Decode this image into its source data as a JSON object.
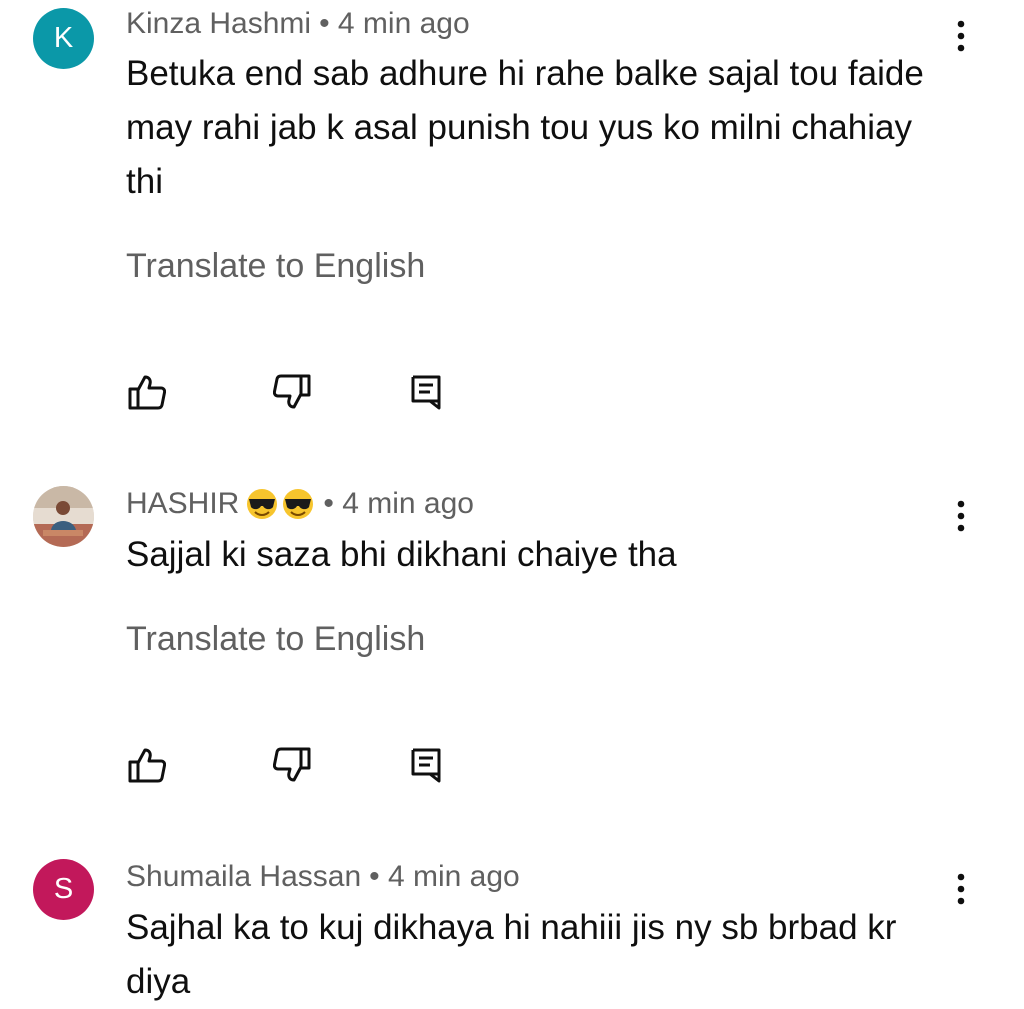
{
  "comments": [
    {
      "author": "Kinza Hashmi",
      "time": "• 4 min ago",
      "avatar_letter": "K",
      "avatar_color": "#0b98a8",
      "text": "Betuka end sab adhure hi rahe balke sajal tou faide may rahi jab k asal punish tou yus ko milni chahiay thi",
      "translate": "Translate to English"
    },
    {
      "author": "HASHIR",
      "time": "• 4 min ago",
      "author_emoji": "smiling-face-with-sunglasses-icon",
      "text": "Sajjal ki saza bhi dikhani chaiye tha",
      "translate": "Translate to English"
    },
    {
      "author": "Shumaila Hassan",
      "time": "• 4 min ago",
      "avatar_letter": "S",
      "avatar_color": "#c2185b",
      "text": "Sajhal ka to kuj dikhaya hi nahiii jis ny sb brbad kr diya"
    }
  ],
  "icons": {
    "like": "thumbs-up-icon",
    "dislike": "thumbs-down-icon",
    "reply": "reply-icon",
    "menu": "more-vertical-icon"
  }
}
